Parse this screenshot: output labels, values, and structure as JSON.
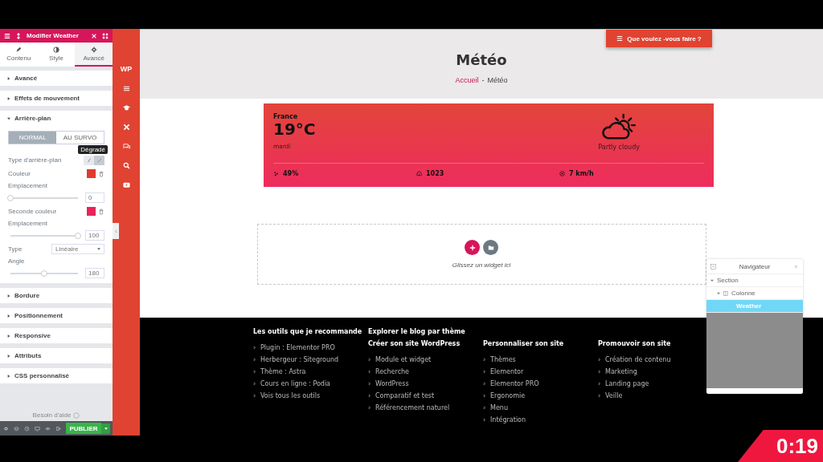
{
  "panel": {
    "title": "Modifier Weather",
    "tabs": [
      {
        "label": "Contenu",
        "selected": false
      },
      {
        "label": "Style",
        "selected": false
      },
      {
        "label": "Avancé",
        "selected": true
      }
    ],
    "sections_before": [
      {
        "title": "Avancé",
        "expanded": false
      },
      {
        "title": "Effets de mouvement",
        "expanded": false
      }
    ],
    "background": {
      "title": "Arrière-plan",
      "expanded": true,
      "states": [
        {
          "label": "NORMAL",
          "selected": true
        },
        {
          "label": "AU SURVO",
          "selected": false
        }
      ],
      "controls": [
        {
          "kind": "type",
          "label": "Type d'arrière-plan",
          "tooltip": "Dégradé"
        },
        {
          "kind": "color",
          "label": "Couleur",
          "color": "#e03a2e"
        },
        {
          "kind": "slider",
          "label": "Emplacement",
          "level": 0,
          "value": "0"
        },
        {
          "kind": "color",
          "label": "Seconde couleur",
          "color": "#e9245a"
        },
        {
          "kind": "slider",
          "label": "Emplacement",
          "level": 1,
          "value": "100"
        },
        {
          "kind": "select",
          "label": "Type",
          "value": "Linéaire"
        },
        {
          "kind": "slider",
          "label": "Angle",
          "level": 0.5,
          "value": "180"
        }
      ]
    },
    "sections_after": [
      {
        "title": "Bordure",
        "expanded": false
      },
      {
        "title": "Positionnement",
        "expanded": false
      },
      {
        "title": "Responsive",
        "expanded": false
      },
      {
        "title": "Attributs",
        "expanded": false
      },
      {
        "title": "CSS personnalisé",
        "expanded": false
      }
    ],
    "help": "Besoin d'aide",
    "publish": "PUBLIER"
  },
  "sidebar": {
    "logo": "WP"
  },
  "page": {
    "menu_button": "Que voulez -vous faire ?",
    "title": "Météo",
    "breadcrumb": {
      "home": "Accueil",
      "separator": "-",
      "current": "Météo"
    },
    "weather": {
      "country": "France",
      "temperature": "19°C",
      "day": "mardi",
      "condition": "Partly cloudy",
      "stats": [
        {
          "kind": "humidity",
          "value": "49%"
        },
        {
          "kind": "pressure",
          "value": "1023"
        },
        {
          "kind": "wind",
          "value": "7 km/h"
        }
      ]
    },
    "dropzone": "Glissez un widget ici",
    "footer": {
      "tools": {
        "heading": "Les outils que je recommande",
        "items": [
          "Plugin : Elementor PRO",
          "Herbergeur : Siteground",
          "Thème : Astra",
          "Cours en ligne : Podia",
          "Vois tous les outils"
        ]
      },
      "blog_heading": "Explorer le blog par thème",
      "blog_columns": [
        {
          "heading": "Créer son site WordPress",
          "items": [
            "Module et widget",
            "Recherche",
            "WordPress",
            "Comparatif et test",
            "Référencement naturel"
          ]
        },
        {
          "heading": "Personnaliser son site",
          "items": [
            "Thèmes",
            "Elementor",
            "Elementor PRO",
            "Ergonomie",
            "Menu",
            "Intégration"
          ]
        },
        {
          "heading": "Promouvoir son site",
          "items": [
            "Création de contenu",
            "Marketing",
            "Landing page",
            "Veille"
          ]
        }
      ]
    }
  },
  "navigator": {
    "title": "Navigateur",
    "tree": [
      {
        "label": "Section",
        "expanded": true,
        "selected": false,
        "children": [
          {
            "label": "Colonne",
            "expanded": true,
            "selected": false,
            "children": [
              {
                "label": "Weather",
                "selected": true
              }
            ]
          }
        ]
      }
    ]
  },
  "timer": "0:19"
}
